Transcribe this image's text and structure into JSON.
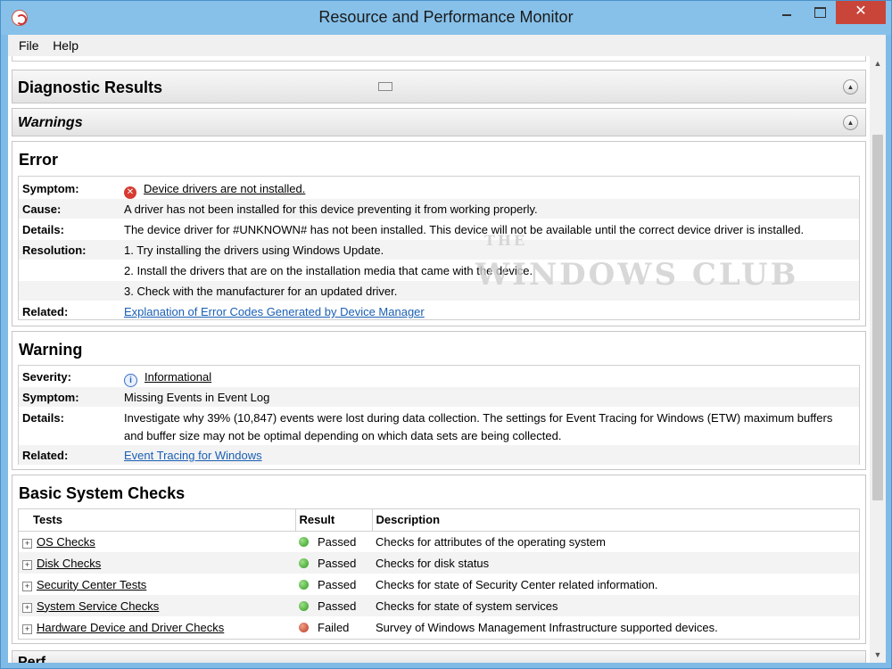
{
  "window": {
    "title": "Resource and Performance Monitor",
    "close_glyph": "✕"
  },
  "menu": [
    "File",
    "Help"
  ],
  "sections": {
    "diagnostic_results": "Diagnostic Results",
    "warnings": "Warnings",
    "next_section_partial": "Perf"
  },
  "error": {
    "title": "Error",
    "symptom_label": "Symptom:",
    "symptom": "Device drivers are not installed.",
    "cause_label": "Cause:",
    "cause": "A driver has not been installed for this device preventing it from working properly.",
    "details_label": "Details:",
    "details": "The device driver for #UNKNOWN# has not been installed. This device will not be available until the correct device driver is installed.",
    "resolution_label": "Resolution:",
    "resolution": [
      "1. Try installing the drivers using Windows Update.",
      "2. Install the drivers that are on the installation media that came with the device.",
      "3. Check with the manufacturer for an updated driver."
    ],
    "related_label": "Related:",
    "related_link": "Explanation of Error Codes Generated by Device Manager"
  },
  "warning": {
    "title": "Warning",
    "severity_label": "Severity:",
    "severity": "Informational",
    "symptom_label": "Symptom:",
    "symptom": "Missing Events in Event Log",
    "details_label": "Details:",
    "details": "Investigate why 39% (10,847) events were lost during data collection. The settings for Event Tracing for Windows (ETW) maximum buffers and buffer size may not be optimal depending on which data sets are being collected.",
    "related_label": "Related:",
    "related_link": "Event Tracing for Windows"
  },
  "basic_checks": {
    "title": "Basic System Checks",
    "columns": [
      "Tests",
      "Result",
      "Description"
    ],
    "rows": [
      {
        "test": "OS Checks",
        "result": "Passed",
        "description": "Checks for attributes of the operating system"
      },
      {
        "test": "Disk Checks",
        "result": "Passed",
        "description": "Checks for disk status"
      },
      {
        "test": "Security Center Tests",
        "result": "Passed",
        "description": "Checks for state of Security Center related information."
      },
      {
        "test": "System Service Checks",
        "result": "Passed",
        "description": "Checks for state of system services"
      },
      {
        "test": "Hardware Device and Driver Checks",
        "result": "Failed",
        "description": "Survey of Windows Management Infrastructure supported devices."
      }
    ]
  },
  "watermark": {
    "line1": "THE",
    "line2": "WINDOWS CLUB"
  },
  "colors": {
    "link": "#1a5fb4",
    "titlebar": "#87c1ea",
    "close_button": "#c9453a",
    "pass": "#2e9a1e",
    "fail": "#b83a1e"
  }
}
